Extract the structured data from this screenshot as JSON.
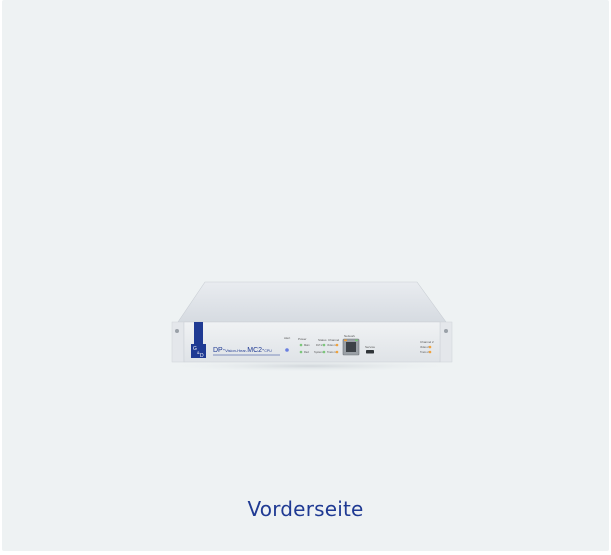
{
  "caption": "Vorderseite",
  "device": {
    "model_prefix": "DP-",
    "model_small_1": "Vision-",
    "model_small_2": "Hear-",
    "model_main": "MC2-",
    "model_suffix": "CPU",
    "logo_letters": [
      "G",
      "&",
      "D"
    ],
    "front_labels": {
      "alert": "Alert",
      "power": "Power",
      "main": "Main",
      "red": "Red",
      "status": "Status",
      "dvi_2": "DVI 2",
      "system": "System",
      "channel_1": "Channel",
      "video_1": "Video 1",
      "trans_1": "Trans 1",
      "network": "Network",
      "service": "Service",
      "channel_2": "Channel 2",
      "video_2": "Video 2",
      "trans_2": "Trans 2"
    },
    "colors": {
      "brand_blue": "#1f3a93",
      "chassis_top": "#dfe3e8",
      "chassis_front": "#e7eaee",
      "led_green": "#7bc67a",
      "led_orange": "#f0a23c",
      "led_blue": "#6a7fe0"
    }
  }
}
